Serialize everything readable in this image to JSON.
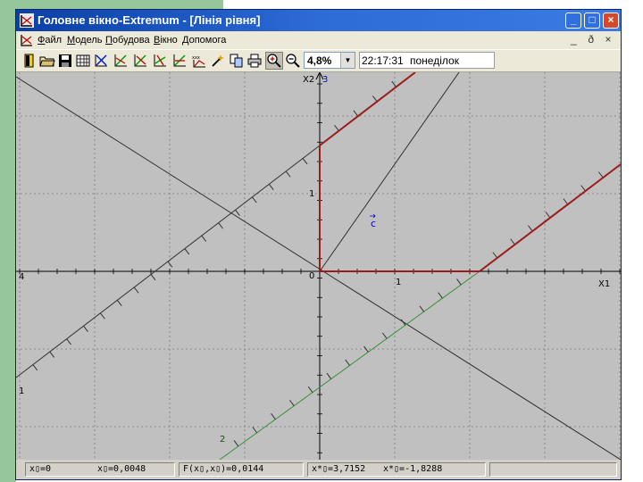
{
  "window": {
    "title": "Головне вікно-Extremum - [Лінія рівня]",
    "controls": [
      "_",
      "□",
      "×"
    ],
    "mdi_controls": [
      "_",
      "ð",
      "×"
    ]
  },
  "menu": {
    "items": [
      "Файл",
      "Модель",
      "Побудова",
      "Вікно",
      "Допомога"
    ],
    "underline": [
      "Ф",
      "М",
      "П",
      "В",
      "Д"
    ]
  },
  "toolbar": {
    "zoom_value": "4,8%",
    "time": "22:17:31",
    "day": "понеділок",
    "icons": [
      "exit-icon",
      "open-folder-icon",
      "save-icon",
      "grid-icon",
      "axes-tool-icon",
      "chart-tool-1-icon",
      "chart-tool-2-icon",
      "chart-tool-3-icon",
      "chart-tool-4-icon",
      "extremum-tool-icon",
      "copy-icon",
      "print-icon",
      "zoom-in-icon",
      "zoom-out-icon"
    ]
  },
  "plot": {
    "x_axis_label": "X1",
    "y_axis_label": "X2",
    "labels": {
      "origin": "0",
      "x_tick_1": "1",
      "y_tick_1": "1",
      "line_1": "1",
      "line_2": "2",
      "line_3": "3",
      "line_4": "4",
      "gradient": "c"
    }
  },
  "status": {
    "field_1": "x▯=0",
    "field_2": "x▯=0,0048",
    "field_3": "F(x▯,x▯)=0,0144",
    "field_4": "x*▯=3,7152",
    "field_5": "x*▯=-1,8288"
  }
}
